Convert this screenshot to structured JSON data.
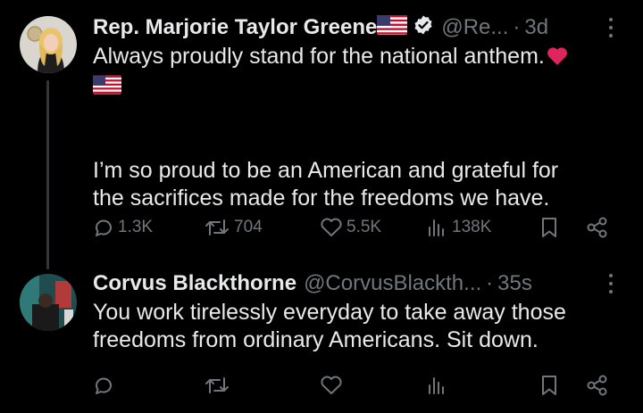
{
  "tweets": [
    {
      "display_name": "Rep. Marjorie Taylor Greene",
      "handle": "@Re...",
      "time": "3d",
      "verified": true,
      "body_lines": [
        "Always proudly stand for the national anthem.",
        "I’m so proud to be an American and grateful for",
        "the sacrifices made for the freedoms we have."
      ],
      "emoji": [
        "red-heart",
        "us-flag"
      ],
      "metrics": {
        "replies": "1.3K",
        "reposts": "704",
        "likes": "5.5K",
        "views": "138K"
      }
    },
    {
      "display_name": "Corvus Blackthorne",
      "handle": "@CorvusBlackth...",
      "time": "35s",
      "verified": false,
      "body_lines": [
        "You work tirelessly everyday to take away those",
        "freedoms from ordinary Americans. Sit down."
      ],
      "metrics": {
        "replies": "",
        "reposts": "",
        "likes": "",
        "views": ""
      }
    }
  ],
  "separator": "·",
  "colors": {
    "background": "#000000",
    "text": "#e7e9ea",
    "muted": "#71767b",
    "verified": "#1d9bf0",
    "heart": "#f91880"
  }
}
